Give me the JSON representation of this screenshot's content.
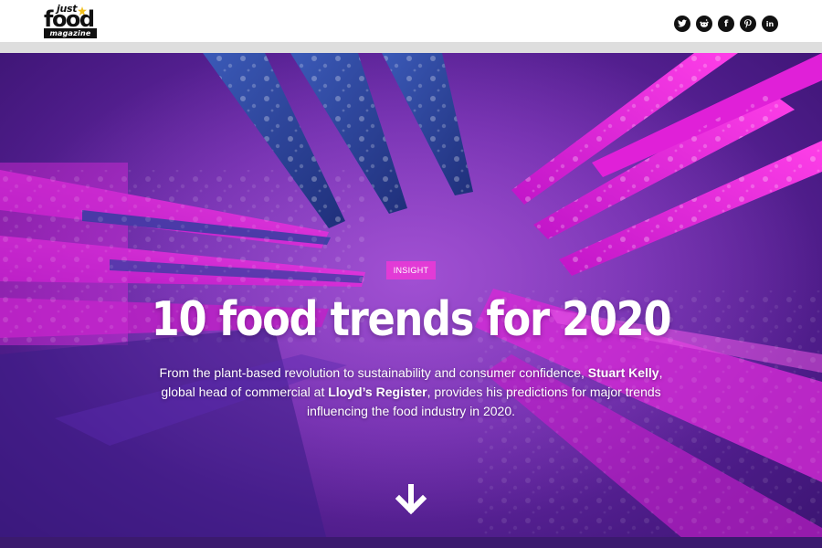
{
  "header": {
    "logo": {
      "just": "just",
      "food": "food",
      "magazine": "magazine"
    },
    "socials": [
      {
        "icon": "twitter-icon",
        "glyph": ""
      },
      {
        "icon": "reddit-icon",
        "glyph": ""
      },
      {
        "icon": "facebook-icon",
        "glyph": "f"
      },
      {
        "icon": "pinterest-icon",
        "glyph": ""
      },
      {
        "icon": "linkedin-icon",
        "glyph": "in"
      }
    ]
  },
  "hero": {
    "tag": "INSIGHT",
    "title": "10 food trends for 2020",
    "desc_1": "From the plant-based revolution to sustainability and consumer confidence, ",
    "author": "Stuart Kelly",
    "desc_2": ", global head of commercial at ",
    "company": "Lloyd’s Register",
    "desc_3": ", provides his predictions for major trends influencing the food industry in 2020.",
    "scroll_icon": "arrow-down-icon"
  },
  "colors": {
    "accent": "#e23bd6",
    "hero_dark": "#3a1470",
    "hero_mid": "#8a3fc2",
    "fork_blue": "#2b3f9e",
    "fork_pink": "#e020d8"
  }
}
